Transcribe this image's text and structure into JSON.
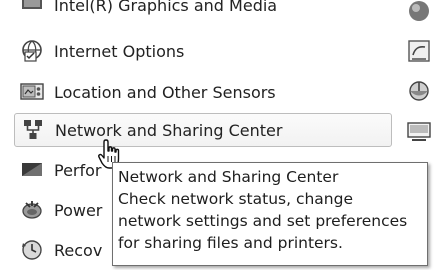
{
  "items": [
    {
      "label": "Intel(R) Graphics and Media",
      "icon": "intel-graphics-icon"
    },
    {
      "label": "Internet Options",
      "icon": "internet-options-icon"
    },
    {
      "label": "Location and Other Sensors",
      "icon": "location-sensors-icon"
    },
    {
      "label": "Network and Sharing Center",
      "icon": "network-sharing-icon"
    },
    {
      "label": "Perfor",
      "icon": "performance-icon"
    },
    {
      "label": "Power",
      "icon": "power-options-icon"
    },
    {
      "label": "Recov",
      "icon": "recovery-icon"
    }
  ],
  "tooltip": {
    "title": "Network and Sharing Center",
    "line1": "Check network status, change",
    "line2": "network settings and set preferences",
    "line3": "for sharing files and printers."
  }
}
